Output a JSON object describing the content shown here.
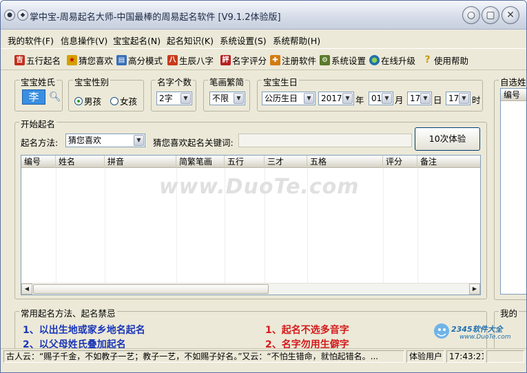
{
  "window": {
    "title": "掌中宝-周易起名大师-中国最棒的周易起名软件 [V9.1.2体验版]",
    "minimize_symbol": "○",
    "maximize_symbol": "▢",
    "close_symbol": "✕"
  },
  "menu": [
    {
      "label": "我的软件(F)"
    },
    {
      "label": "信息操作(V)"
    },
    {
      "label": "宝宝起名(N)"
    },
    {
      "label": "起名知识(K)"
    },
    {
      "label": "系统设置(S)"
    },
    {
      "label": "系统帮助(H)"
    }
  ],
  "toolbar": [
    {
      "label": "五行起名",
      "icon": "wuxing-icon",
      "glyph": "吉",
      "color": "#c03020"
    },
    {
      "label": "猜您喜欢",
      "icon": "star-icon",
      "glyph": "★",
      "color": "#d4a000"
    },
    {
      "label": "高分模式",
      "icon": "chart-icon",
      "glyph": "▤",
      "color": "#3a6fb8"
    },
    {
      "label": "生辰八字",
      "icon": "bazi-icon",
      "glyph": "八",
      "color": "#c83a1a"
    },
    {
      "label": "名字评分",
      "icon": "score-icon",
      "glyph": "評",
      "color": "#b82020"
    },
    {
      "label": "注册软件",
      "icon": "gift-icon",
      "glyph": "✚",
      "color": "#d47a10"
    },
    {
      "label": "系统设置",
      "icon": "settings-icon",
      "glyph": "⚙",
      "color": "#5a7a2a"
    },
    {
      "label": "在线升级",
      "icon": "globe-icon",
      "glyph": "●",
      "color": "#1f6fb0"
    },
    {
      "label": "使用帮助",
      "icon": "help-icon",
      "glyph": "?",
      "color": "#c89a10"
    }
  ],
  "surname": {
    "legend": "宝宝姓氏",
    "value": "李"
  },
  "gender": {
    "legend": "宝宝性别",
    "male": "男孩",
    "female": "女孩",
    "selected": "男孩"
  },
  "count": {
    "legend": "名字个数",
    "value": "2字"
  },
  "script": {
    "legend": "笔画繁简",
    "value": "不限"
  },
  "birthday": {
    "legend": "宝宝生日",
    "calendar": "公历生日",
    "year": "2017",
    "year_unit": "年",
    "month": "01",
    "month_unit": "月",
    "day": "17",
    "day_unit": "日",
    "hour": "17",
    "hour_unit": "时"
  },
  "naming": {
    "legend": "开始起名",
    "method_label": "起名方法:",
    "method_value": "猜您喜欢",
    "keyword_label": "猜您喜欢起名关键词:",
    "keyword_value": "",
    "run_button": "10次体验"
  },
  "results_table": {
    "columns": [
      "编号",
      "姓名",
      "拼音",
      "简繁笔画",
      "五行",
      "三才",
      "五格",
      "评分",
      "备注"
    ]
  },
  "side_panel": {
    "legend": "自选姓",
    "column": "编号",
    "legend2": "我的"
  },
  "watermark": "www.DuoTe.com",
  "tips": {
    "legend": "常用起名方法、起名禁忌",
    "left": [
      "1、以出生地或家乡地名起名",
      "2、以父母姓氏叠加起名"
    ],
    "right": [
      "1、起名不选多音字",
      "2、名字勿用生僻字"
    ]
  },
  "logo": {
    "text": "2345软件大全",
    "url": "www.DuoTe.com"
  },
  "status": {
    "message": "古人云：“赐子千金，不如教子一艺；教子一艺，不如赐子好名。”又云：“不怕生错命，就怕起错名。...",
    "user": "体验用户",
    "time": "17:43:21"
  }
}
